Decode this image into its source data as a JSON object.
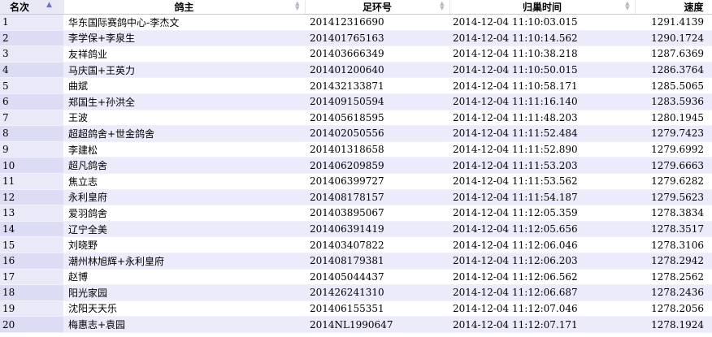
{
  "headers": {
    "rank": "名次",
    "owner": "鸽主",
    "ring": "足环号",
    "time": "归巢时间",
    "speed": "速度"
  },
  "rows": [
    {
      "rank": "1",
      "owner": "华东国际赛鸽中心-李杰文",
      "ring": "201412316690",
      "time": "2014-12-04 11:10:03.015",
      "speed": "1291.4139"
    },
    {
      "rank": "2",
      "owner": "李学保+李泉生",
      "ring": "201401765163",
      "time": "2014-12-04 11:10:14.562",
      "speed": "1290.1724"
    },
    {
      "rank": "3",
      "owner": "友祥鸽业",
      "ring": "201403666349",
      "time": "2014-12-04 11:10:38.218",
      "speed": "1287.6369"
    },
    {
      "rank": "4",
      "owner": "马庆国+王英力",
      "ring": "201401200640",
      "time": "2014-12-04 11:10:50.015",
      "speed": "1286.3764"
    },
    {
      "rank": "5",
      "owner": "曲斌",
      "ring": "201432133871",
      "time": "2014-12-04 11:10:58.171",
      "speed": "1285.5065"
    },
    {
      "rank": "6",
      "owner": "郑国生+孙洪全",
      "ring": "201409150594",
      "time": "2014-12-04 11:11:16.140",
      "speed": "1283.5936"
    },
    {
      "rank": "7",
      "owner": "王波",
      "ring": "201405618595",
      "time": "2014-12-04 11:11:48.203",
      "speed": "1280.1945"
    },
    {
      "rank": "8",
      "owner": "超超鸽舍+世金鸽舍",
      "ring": "201402050556",
      "time": "2014-12-04 11:11:52.484",
      "speed": "1279.7423"
    },
    {
      "rank": "9",
      "owner": "李建松",
      "ring": "201401318658",
      "time": "2014-12-04 11:11:52.890",
      "speed": "1279.6992"
    },
    {
      "rank": "10",
      "owner": "超凡鸽舍",
      "ring": "201406209859",
      "time": "2014-12-04 11:11:53.203",
      "speed": "1279.6663"
    },
    {
      "rank": "11",
      "owner": "焦立志",
      "ring": "201406399727",
      "time": "2014-12-04 11:11:53.562",
      "speed": "1279.6282"
    },
    {
      "rank": "12",
      "owner": "永利皇府",
      "ring": "201408178157",
      "time": "2014-12-04 11:11:54.187",
      "speed": "1279.5623"
    },
    {
      "rank": "13",
      "owner": "爱羽鸽舍",
      "ring": "201403895067",
      "time": "2014-12-04 11:12:05.359",
      "speed": "1278.3834"
    },
    {
      "rank": "14",
      "owner": "辽宁全美",
      "ring": "201406391419",
      "time": "2014-12-04 11:12:05.656",
      "speed": "1278.3517"
    },
    {
      "rank": "15",
      "owner": "刘晓野",
      "ring": "201403407822",
      "time": "2014-12-04 11:12:06.046",
      "speed": "1278.3106"
    },
    {
      "rank": "16",
      "owner": "潮州林旭辉+永利皇府",
      "ring": "201408179381",
      "time": "2014-12-04 11:12:06.203",
      "speed": "1278.2942"
    },
    {
      "rank": "17",
      "owner": "赵博",
      "ring": "201405044437",
      "time": "2014-12-04 11:12:06.562",
      "speed": "1278.2562"
    },
    {
      "rank": "18",
      "owner": "阳光家园",
      "ring": "201426241310",
      "time": "2014-12-04 11:12:06.687",
      "speed": "1278.2436"
    },
    {
      "rank": "19",
      "owner": "沈阳天天乐",
      "ring": "201406155351",
      "time": "2014-12-04 11:12:07.046",
      "speed": "1278.2056"
    },
    {
      "rank": "20",
      "owner": "梅惠志+袁园",
      "ring": "2014NL1990647",
      "time": "2014-12-04 11:12:07.171",
      "speed": "1278.1924"
    }
  ]
}
